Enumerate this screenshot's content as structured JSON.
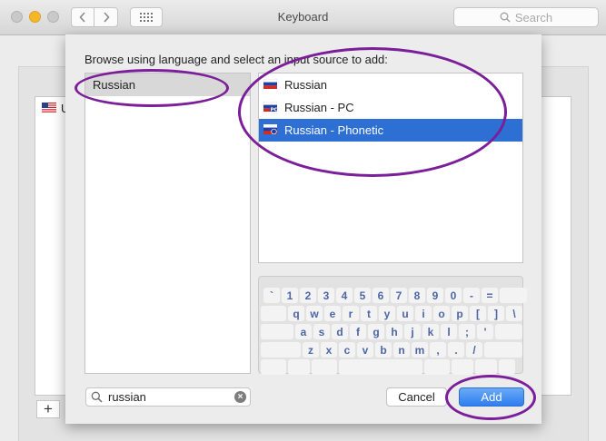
{
  "window": {
    "title": "Keyboard",
    "search_placeholder": "Search"
  },
  "background": {
    "plus_label": "+",
    "partial_letter": "U"
  },
  "sheet": {
    "prompt": "Browse using language and select an input source to add:",
    "languages": [
      {
        "label": "Russian",
        "selected": true
      }
    ],
    "input_sources": [
      {
        "label": "Russian",
        "flag": "russia-flag-icon",
        "selected": false
      },
      {
        "label": "Russian - PC",
        "flag": "russia-pc-flag-icon",
        "selected": false
      },
      {
        "label": "Russian - Phonetic",
        "flag": "russia-phonetic-flag-icon",
        "selected": true
      }
    ],
    "keyboard_rows": [
      [
        "",
        "`",
        "1",
        "2",
        "3",
        "4",
        "5",
        "6",
        "7",
        "8",
        "9",
        "0",
        "-",
        "=",
        ""
      ],
      [
        "",
        "q",
        "w",
        "e",
        "r",
        "t",
        "y",
        "u",
        "i",
        "o",
        "p",
        "[",
        "]",
        "\\"
      ],
      [
        "",
        "a",
        "s",
        "d",
        "f",
        "g",
        "h",
        "j",
        "k",
        "l",
        ";",
        "'",
        ""
      ],
      [
        "",
        "z",
        "x",
        "c",
        "v",
        "b",
        "n",
        "m",
        ",",
        ".",
        "/",
        ""
      ],
      [
        "",
        "",
        "",
        "",
        "",
        "",
        "",
        ""
      ]
    ],
    "filter_value": "russian",
    "cancel_label": "Cancel",
    "add_label": "Add"
  },
  "colors": {
    "selection": "#2e6fd4",
    "annotation": "#7b1e9a",
    "key_text": "#4d66a6"
  }
}
